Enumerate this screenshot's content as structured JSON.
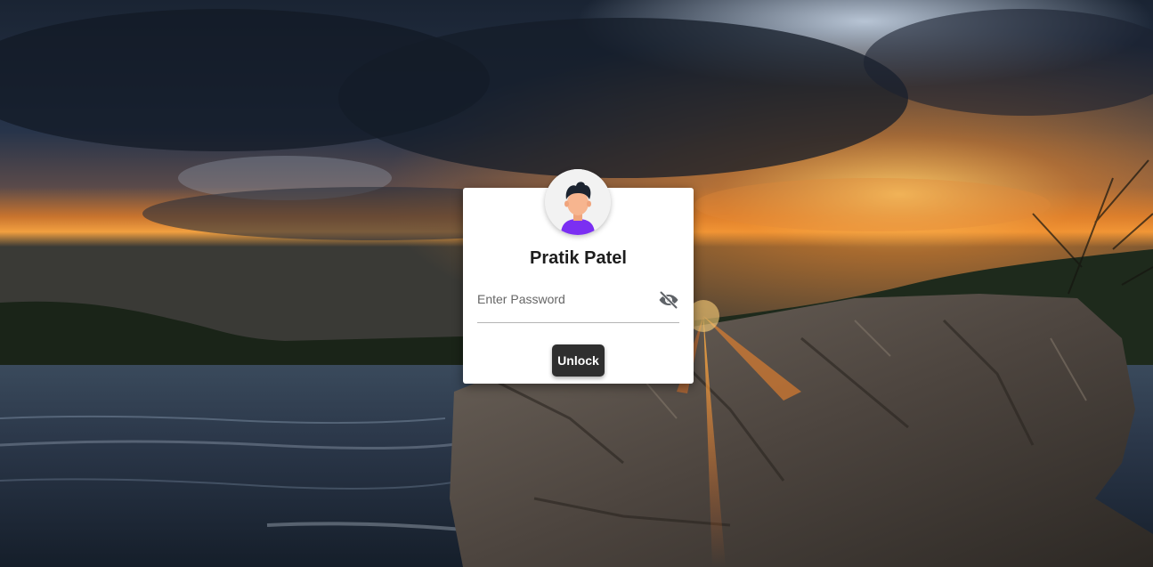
{
  "lock_screen": {
    "user_name": "Pratik Patel",
    "password_placeholder": "Enter Password",
    "password_value": "",
    "toggle_icon": "eye-off-icon",
    "unlock_label": "Unlock",
    "avatar_icon": "user-avatar-icon"
  },
  "colors": {
    "card_bg": "#ffffff",
    "button_bg": "#2f2f2f",
    "button_text": "#ffffff",
    "avatar_shirt": "#7b2ff2",
    "avatar_skin": "#f7b58f",
    "avatar_hair": "#1c2430"
  }
}
